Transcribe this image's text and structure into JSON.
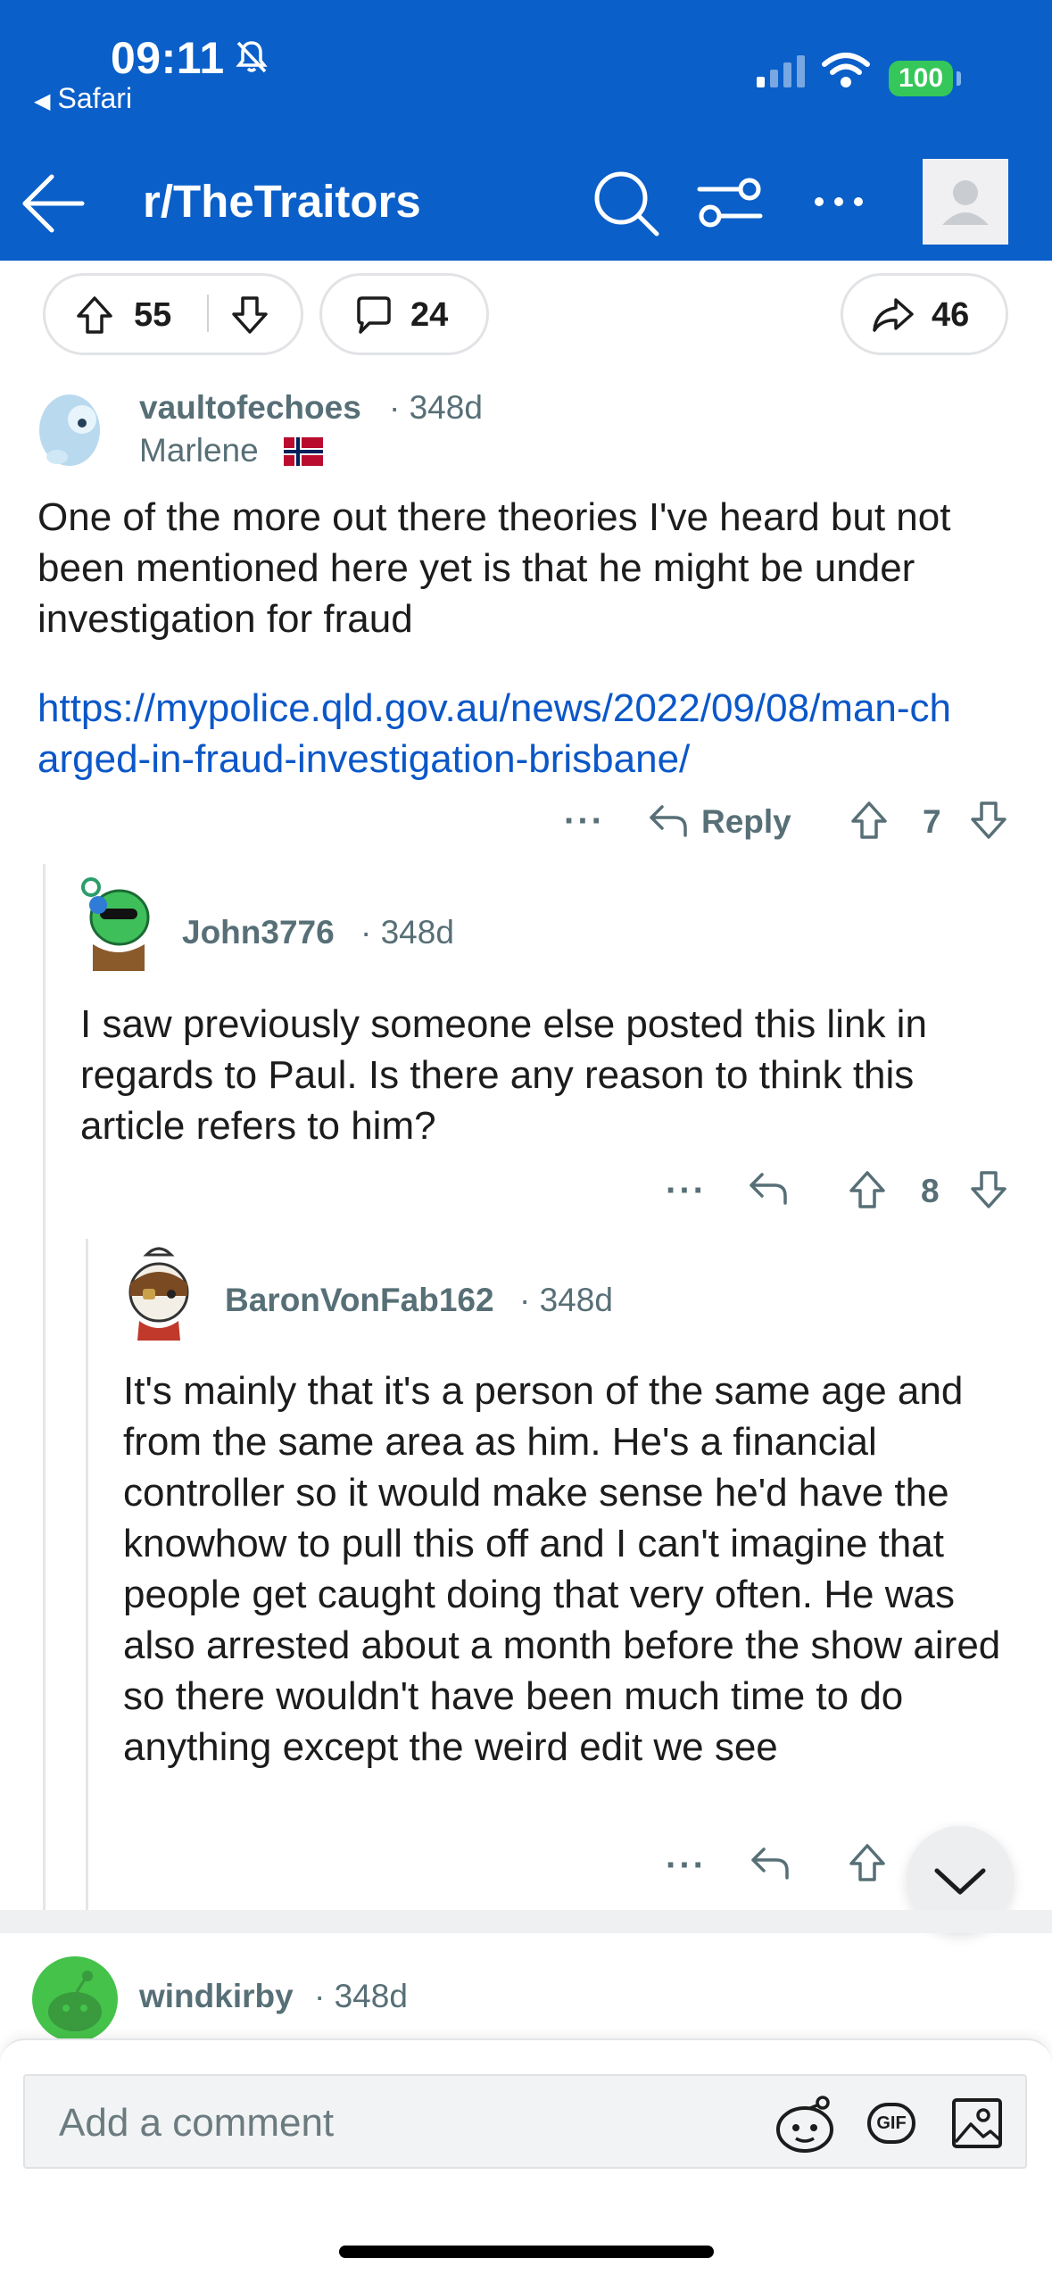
{
  "status_bar": {
    "time": "09:11",
    "back_app": "Safari",
    "battery": "100"
  },
  "nav": {
    "title": "r/TheTraitors"
  },
  "post_actions": {
    "upvotes": "55",
    "comments": "24",
    "shares": "46"
  },
  "comments": [
    {
      "username": "vaultofechoes",
      "age": "348d",
      "flair": "Marlene",
      "body": "One of the more out there theories I've heard but not been mentioned here yet is that he might be under investigation for fraud",
      "link": "https://mypolice.qld.gov.au/news/2022/09/08/man-charged-in-fraud-investigation-brisbane/",
      "reply_label": "Reply",
      "score": "7"
    },
    {
      "username": "John3776",
      "age": "348d",
      "body": "I saw previously someone else posted this link in regards to Paul. Is there any reason to think this article refers to him?",
      "score": "8"
    },
    {
      "username": "BaronVonFab162",
      "age": "348d",
      "body": "It's mainly that it's a person of the same age and from the same area as him. He's a financial controller so it would make sense he'd have the knowhow to pull this off and I can't imagine that people get caught doing that very often. He was also arrested about a month before the show aired so there wouldn't have been much time to do anything except the weird edit we see"
    },
    {
      "username": "windkirby",
      "age": "348d"
    }
  ],
  "composer": {
    "placeholder": "Add a comment",
    "gif_label": "GIF"
  },
  "colors": {
    "header": "#0a5fc9",
    "link": "#0b57c8",
    "meta": "#576f76",
    "battery": "#35c759"
  },
  "icons": [
    "bell-slash-icon",
    "signal-icon",
    "wifi-icon",
    "back-arrow-icon",
    "search-icon",
    "filter-icon",
    "more-icon",
    "upvote-icon",
    "downvote-icon",
    "comment-icon",
    "share-icon",
    "reply-icon",
    "chevron-down-icon",
    "snoo-icon",
    "gif-icon",
    "image-icon"
  ]
}
